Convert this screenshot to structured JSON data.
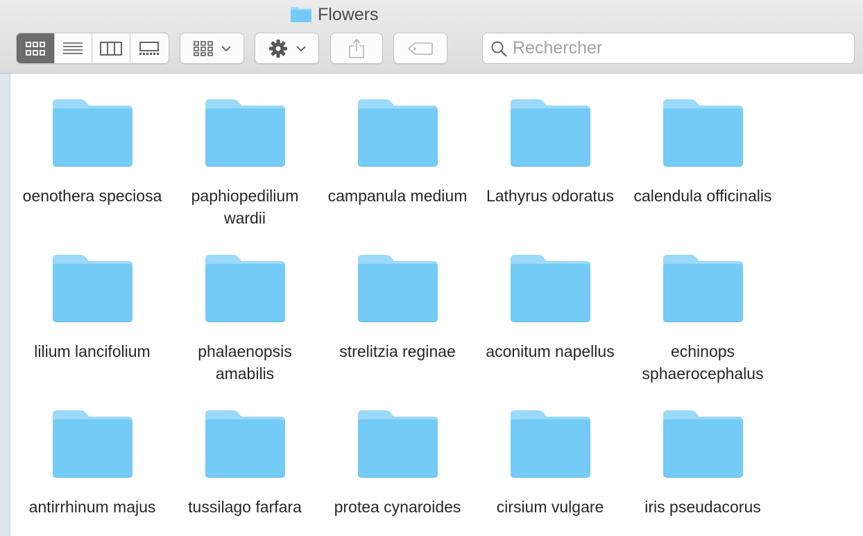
{
  "window": {
    "title": "Flowers",
    "title_icon": "folder-icon"
  },
  "toolbar": {
    "view_modes": [
      {
        "name": "icon-view",
        "icon": "grid-icon",
        "active": true
      },
      {
        "name": "list-view",
        "icon": "list-icon",
        "active": false
      },
      {
        "name": "column-view",
        "icon": "columns-icon",
        "active": false
      },
      {
        "name": "gallery-view",
        "icon": "gallery-icon",
        "active": false
      }
    ],
    "arrange_button": {
      "icon": "grid-icon",
      "dropdown_icon": "chevron-down-icon"
    },
    "action_button": {
      "icon": "gear-icon",
      "dropdown_icon": "chevron-down-icon"
    },
    "share_button": {
      "icon": "share-icon"
    },
    "tags_button": {
      "icon": "tag-icon"
    },
    "search": {
      "placeholder": "Rechercher",
      "value": "",
      "icon": "magnifier-icon"
    }
  },
  "colors": {
    "folder": "#74cbf5",
    "folder_tab": "#9ad9f8",
    "active_segment": "#6c6c6c",
    "sidebar_strip": "#dfe7ee"
  },
  "items": [
    {
      "label": "oenothera speciosa",
      "type": "folder"
    },
    {
      "label": "paphiopedilium wardii",
      "type": "folder"
    },
    {
      "label": "campanula medium",
      "type": "folder"
    },
    {
      "label": "Lathyrus odoratus",
      "type": "folder"
    },
    {
      "label": "calendula officinalis",
      "type": "folder"
    },
    {
      "label": "lilium lancifolium",
      "type": "folder"
    },
    {
      "label": "phalaenopsis amabilis",
      "type": "folder"
    },
    {
      "label": "strelitzia reginae",
      "type": "folder"
    },
    {
      "label": "aconitum napellus",
      "type": "folder"
    },
    {
      "label": "echinops sphaerocephalus",
      "type": "folder"
    },
    {
      "label": "antirrhinum majus",
      "type": "folder"
    },
    {
      "label": "tussilago farfara",
      "type": "folder"
    },
    {
      "label": "protea cynaroides",
      "type": "folder"
    },
    {
      "label": "cirsium vulgare",
      "type": "folder"
    },
    {
      "label": "iris pseudacorus",
      "type": "folder"
    }
  ]
}
